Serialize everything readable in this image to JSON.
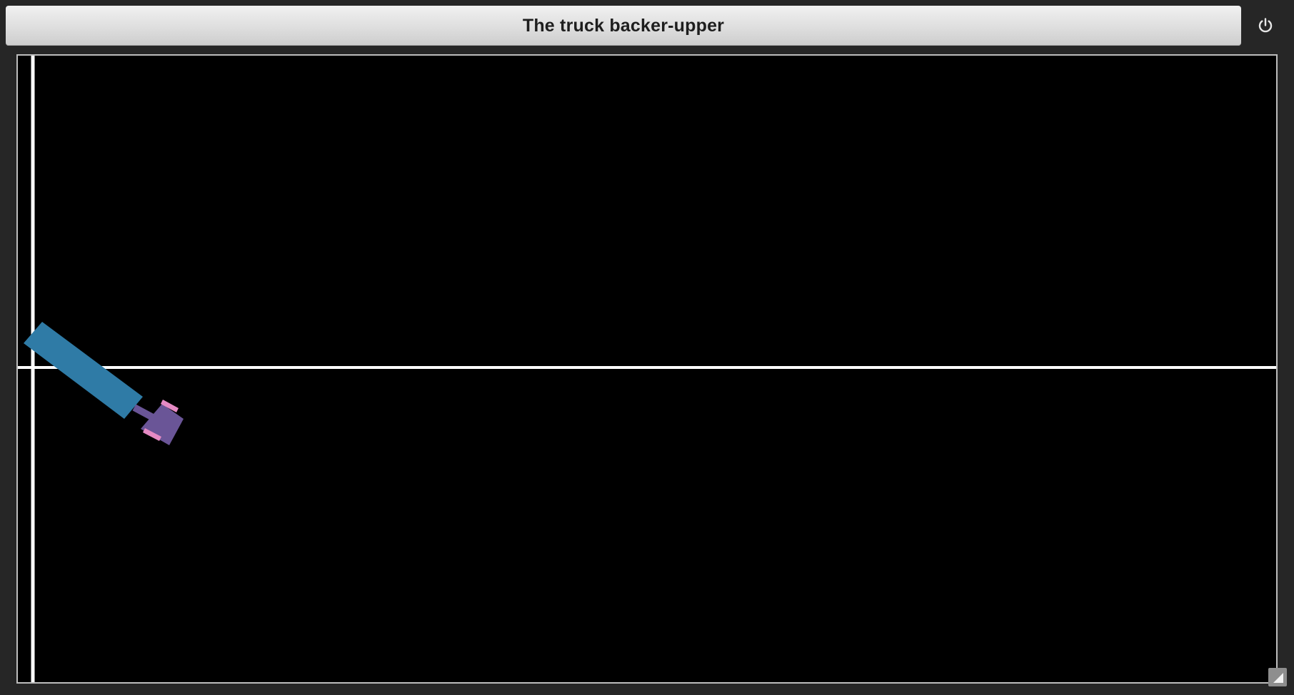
{
  "window": {
    "title": "The truck backer-upper"
  },
  "controls": {
    "power_icon": "power-icon",
    "resize_icon": "resize-grip-icon"
  },
  "colors": {
    "background": "#262626",
    "canvas": "#000000",
    "guide_lines": "#ffffff",
    "trailer": "#2f7ba6",
    "cab": "#6a5597",
    "wheels": "#e58ac4"
  }
}
